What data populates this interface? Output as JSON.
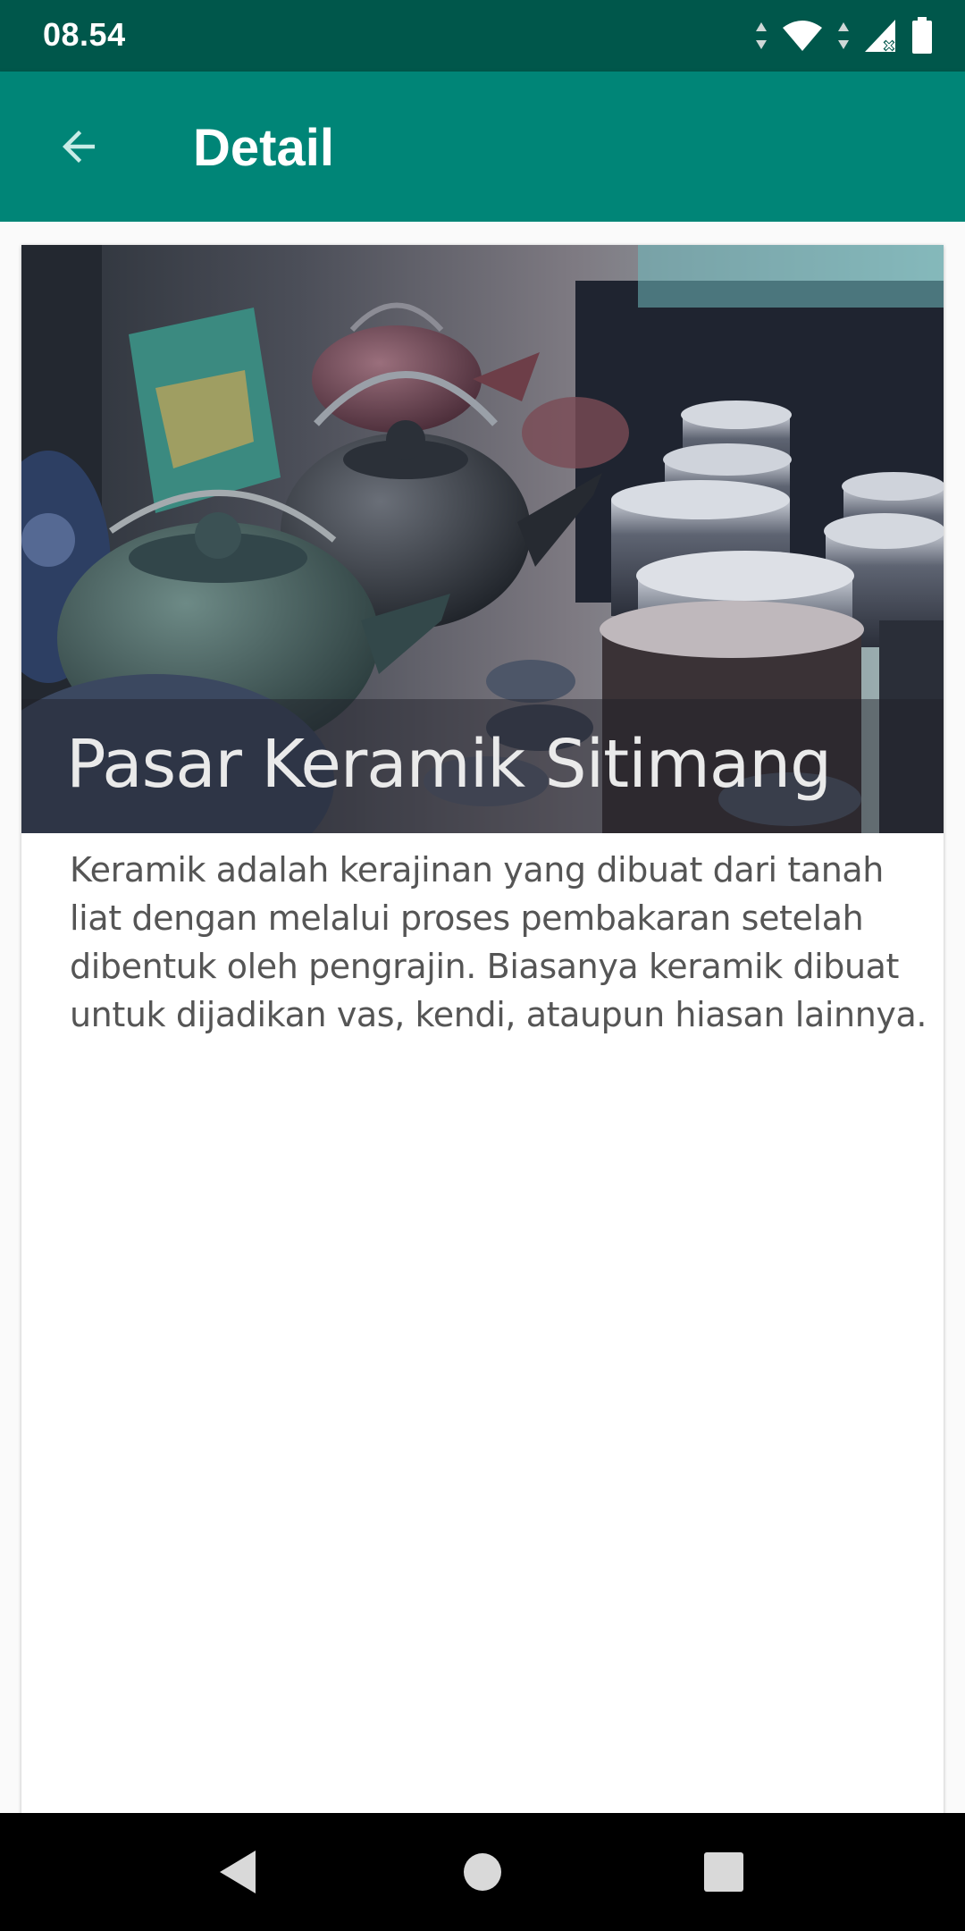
{
  "status_bar": {
    "time": "08.54",
    "icons": [
      "data-arrows-icon",
      "wifi-icon",
      "signal-icon",
      "battery-icon"
    ]
  },
  "app_bar": {
    "title": "Detail",
    "back_icon": "arrow-back-icon",
    "background_color": "#008577",
    "status_color": "#00574b"
  },
  "detail": {
    "name": "Pasar Keramik Sitimang",
    "description": "Keramik adalah kerajinan yang dibuat dari tanah liat dengan melalui proses pembakaran setelah dibentuk oleh pengrajin. Biasanya keramik dibuat untuk dijadikan vas, kendi, ataupun hiasan lainnya.",
    "image_subject": "ceramic teapots photo"
  },
  "nav_bar": {
    "buttons": [
      "back-triangle-icon",
      "home-circle-icon",
      "recents-square-icon"
    ]
  }
}
